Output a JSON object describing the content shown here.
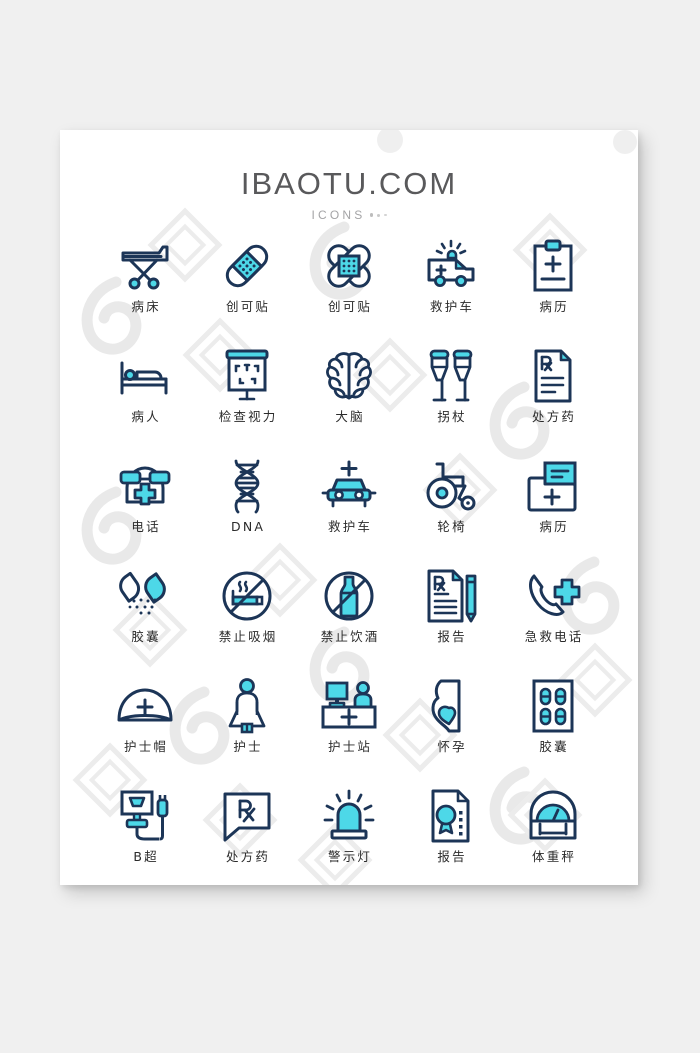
{
  "header": {
    "title": "IBAOTU.COM",
    "subtitle": "ICONS",
    "dots": 3
  },
  "palette": {
    "background": "#f0f0f0",
    "card": "#ffffff",
    "stroke_dark": "#1c3557",
    "accent_cyan": "#4dd8e8",
    "accent_cyan_alt": "#3fcfe0",
    "title_text": "#59595b",
    "subtitle_text": "#a4a4a6",
    "caption_text": "#2b2b2b",
    "watermark": "#e8e8e8"
  },
  "grid": {
    "columns": 5,
    "rows": 6,
    "count": 30
  },
  "icons": [
    {
      "id": "hospital-bed",
      "label": "病床",
      "icon_name": "stretcher-icon"
    },
    {
      "id": "bandaid-1",
      "label": "创可贴",
      "icon_name": "bandaid-icon"
    },
    {
      "id": "bandaid-cross",
      "label": "创可贴",
      "icon_name": "bandaid-cross-icon"
    },
    {
      "id": "ambulance-van",
      "label": "救护车",
      "icon_name": "ambulance-van-icon"
    },
    {
      "id": "medical-record-1",
      "label": "病历",
      "icon_name": "clipboard-icon"
    },
    {
      "id": "patient",
      "label": "病人",
      "icon_name": "patient-bed-icon"
    },
    {
      "id": "eye-test",
      "label": "检查视力",
      "icon_name": "eye-chart-icon"
    },
    {
      "id": "brain",
      "label": "大脑",
      "icon_name": "brain-icon"
    },
    {
      "id": "crutches",
      "label": "拐杖",
      "icon_name": "crutches-icon"
    },
    {
      "id": "prescription-1",
      "label": "处方药",
      "icon_name": "rx-document-icon"
    },
    {
      "id": "telephone",
      "label": "电话",
      "icon_name": "telephone-icon"
    },
    {
      "id": "dna",
      "label": "DNA",
      "icon_name": "dna-helix-icon"
    },
    {
      "id": "ambulance-car",
      "label": "救护车",
      "icon_name": "ambulance-car-icon"
    },
    {
      "id": "wheelchair",
      "label": "轮椅",
      "icon_name": "wheelchair-icon"
    },
    {
      "id": "medical-record-2",
      "label": "病历",
      "icon_name": "file-folder-icon"
    },
    {
      "id": "capsule-powder",
      "label": "胶囊",
      "icon_name": "capsule-open-icon"
    },
    {
      "id": "no-smoking",
      "label": "禁止吸烟",
      "icon_name": "no-smoking-icon"
    },
    {
      "id": "no-alcohol",
      "label": "禁止饮酒",
      "icon_name": "no-alcohol-icon"
    },
    {
      "id": "report-rx",
      "label": "报告",
      "icon_name": "rx-report-pencil-icon"
    },
    {
      "id": "emergency-call",
      "label": "急救电话",
      "icon_name": "emergency-phone-icon"
    },
    {
      "id": "nurse-cap",
      "label": "护士帽",
      "icon_name": "nurse-cap-icon"
    },
    {
      "id": "nurse",
      "label": "护士",
      "icon_name": "nurse-figure-icon"
    },
    {
      "id": "nurse-station",
      "label": "护士站",
      "icon_name": "reception-desk-icon"
    },
    {
      "id": "pregnancy",
      "label": "怀孕",
      "icon_name": "pregnant-belly-icon"
    },
    {
      "id": "pill-pack",
      "label": "胶囊",
      "icon_name": "blister-pack-icon"
    },
    {
      "id": "ultrasound",
      "label": "B超",
      "icon_name": "ultrasound-monitor-icon"
    },
    {
      "id": "prescription-2",
      "label": "处方药",
      "icon_name": "rx-speech-bubble-icon"
    },
    {
      "id": "warning-light",
      "label": "警示灯",
      "icon_name": "siren-light-icon"
    },
    {
      "id": "report-award",
      "label": "报告",
      "icon_name": "certificate-icon"
    },
    {
      "id": "weight-scale",
      "label": "体重秤",
      "icon_name": "weight-scale-icon"
    }
  ]
}
